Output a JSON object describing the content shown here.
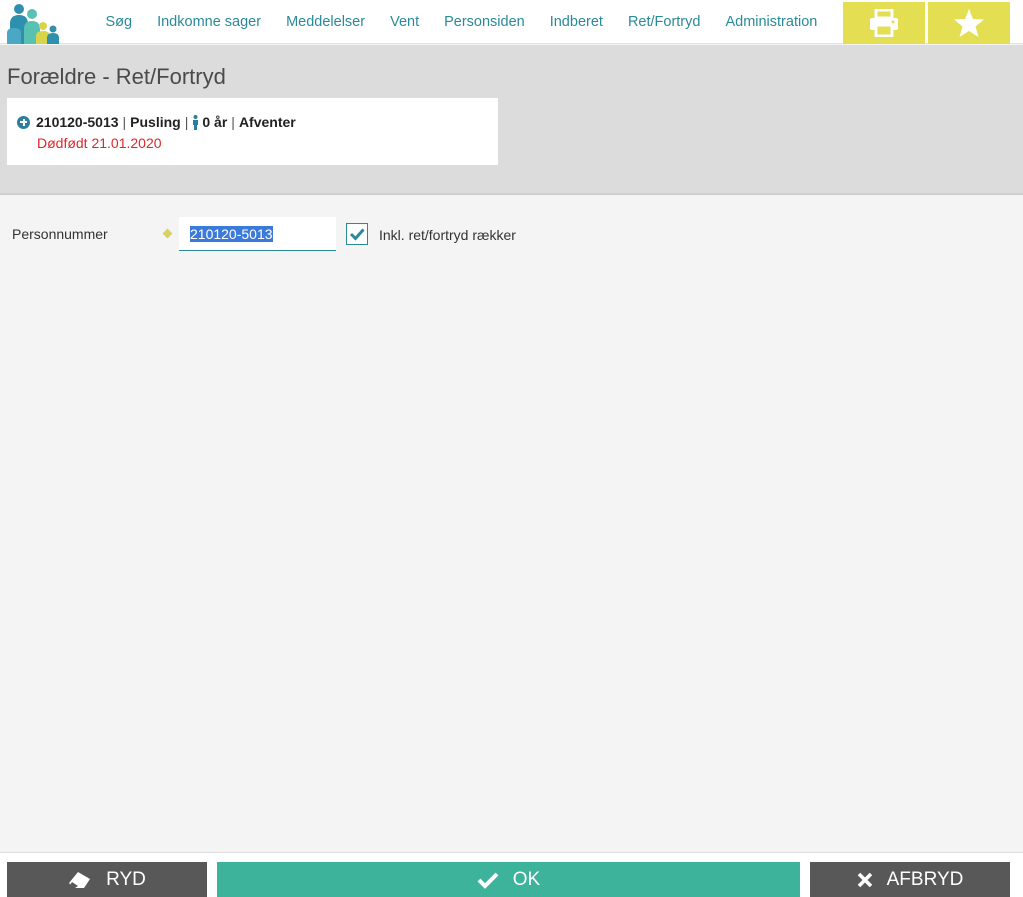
{
  "nav": {
    "items": [
      "Søg",
      "Indkomne sager",
      "Meddelelser",
      "Vent",
      "Personsiden",
      "Indberet",
      "Ret/Fortryd",
      "Administration"
    ]
  },
  "toolbar": {
    "print_icon": "print-icon",
    "star_icon": "star-icon"
  },
  "page": {
    "title": "Forældre - Ret/Fortryd"
  },
  "person": {
    "id": "210120-5013",
    "name": "Pusling",
    "age": "0 år",
    "status": "Afventer",
    "note": "Dødfødt 21.01.2020"
  },
  "form": {
    "personnummer_label": "Personnummer",
    "personnummer_value": "210120-5013",
    "include_label": "Inkl. ret/fortryd rækker",
    "include_checked": true
  },
  "actions": {
    "ryd": "RYD",
    "ok": "OK",
    "afbryd": "AFBRYD"
  },
  "colors": {
    "accent": "#2a8a9a",
    "tool": "#e3de52",
    "ok": "#3db39c",
    "dark_button": "#585858",
    "warning_text": "#e0262a"
  }
}
